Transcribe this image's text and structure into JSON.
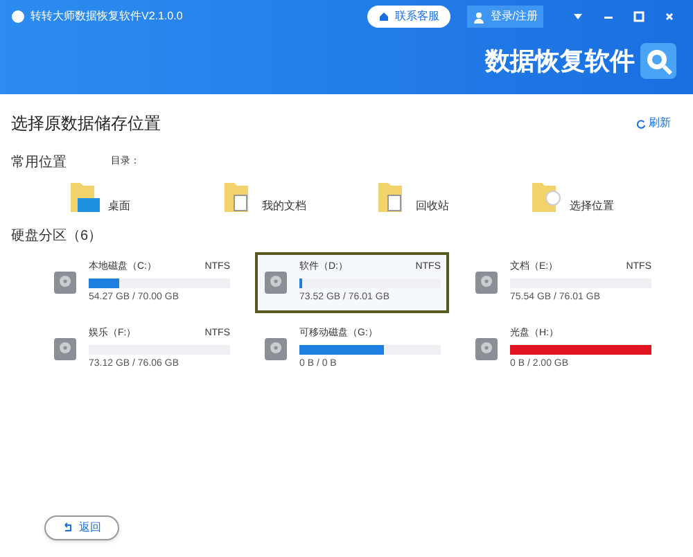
{
  "window": {
    "title": "转转大师数据恢复软件V2.1.0.0"
  },
  "header": {
    "service_button": "联系客服",
    "login_button": "登录/注册",
    "logo_text": "数据恢复软件"
  },
  "heading": "选择原数据储存位置",
  "refresh": "刷新",
  "common": {
    "title": "常用位置",
    "dir_label": "目录：",
    "items": [
      {
        "label": "桌面",
        "kind": "desktop"
      },
      {
        "label": "我的文档",
        "kind": "documents"
      },
      {
        "label": "回收站",
        "kind": "recycle"
      },
      {
        "label": "选择位置",
        "kind": "custom"
      }
    ]
  },
  "partitions": {
    "title": "硬盘分区（6）",
    "drives": [
      {
        "name": "本地磁盘（C:）",
        "fs": "NTFS",
        "usage": "54.27 GB / 70.00 GB",
        "level": 0.22,
        "color": "#1e7fe0",
        "selected": false
      },
      {
        "name": "软件（D:）",
        "fs": "NTFS",
        "usage": "73.52 GB / 76.01 GB",
        "level": 0.02,
        "color": "#1e7fe0",
        "selected": true
      },
      {
        "name": "文档（E:）",
        "fs": "NTFS",
        "usage": "75.54 GB / 76.01 GB",
        "selected": false
      },
      {
        "name": "娱乐（F:）",
        "fs": "NTFS",
        "usage": "73.12 GB / 76.06 GB",
        "selected": false
      },
      {
        "name": "可移动磁盘（G:）",
        "usage": "0 B / 0 B",
        "level": 0.6,
        "color": "#1e7fe0",
        "selected": false
      },
      {
        "name": "光盘（H:）",
        "usage": "0 B / 2.00 GB",
        "level": 1,
        "color": "#e0141e",
        "selected": false
      }
    ]
  },
  "back_button": "返回"
}
